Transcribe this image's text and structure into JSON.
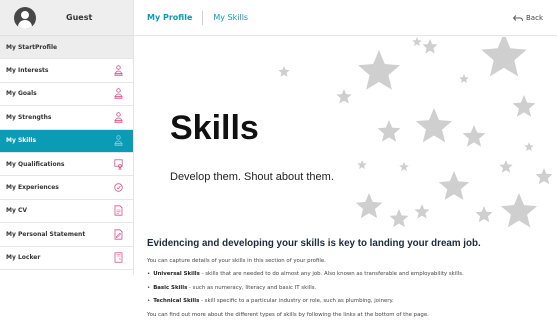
{
  "user": {
    "name": "Guest"
  },
  "sidebar": {
    "items": [
      {
        "label": "My StartProfile",
        "icon": "",
        "state": "grey"
      },
      {
        "label": "My Interests",
        "icon": "person-icon",
        "state": ""
      },
      {
        "label": "My Goals",
        "icon": "person-icon",
        "state": ""
      },
      {
        "label": "My Strengths",
        "icon": "person-icon",
        "state": ""
      },
      {
        "label": "My Skills",
        "icon": "person-icon",
        "state": "active"
      },
      {
        "label": "My Qualifications",
        "icon": "certificate-icon",
        "state": ""
      },
      {
        "label": "My Experiences",
        "icon": "check-circle-icon",
        "state": ""
      },
      {
        "label": "My CV",
        "icon": "document-icon",
        "state": ""
      },
      {
        "label": "My Personal Statement",
        "icon": "document-edit-icon",
        "state": ""
      },
      {
        "label": "My Locker",
        "icon": "locker-icon",
        "state": ""
      }
    ]
  },
  "header": {
    "tabs": [
      {
        "label": "My Profile"
      },
      {
        "label": "My Skills"
      }
    ],
    "back_label": "Back"
  },
  "hero": {
    "title": "Skills",
    "subtitle": "Develop them. Shout about them."
  },
  "main": {
    "headline": "Evidencing and developing your skills is key to landing your dream job.",
    "intro": "You can capture details of your skills in this section of your profile.",
    "bullets": [
      {
        "term": "Universal Skills",
        "text": " - skills that are needed to do almost any job.  Also known as transferable and employability skills."
      },
      {
        "term": "Basic Skills",
        "text": " - such as numeracy, literacy and basic IT skills."
      },
      {
        "term": "Technical Skills",
        "text": " - skill specific to a particular industry or role, such as plumbing, joinery."
      }
    ],
    "outro": "You can find out more about the different types of skills by following the links at the bottom of the page."
  },
  "colors": {
    "accent": "#0a9bb5",
    "icon_pink": "#d6548a",
    "star_grey": "#cfcfcf"
  }
}
